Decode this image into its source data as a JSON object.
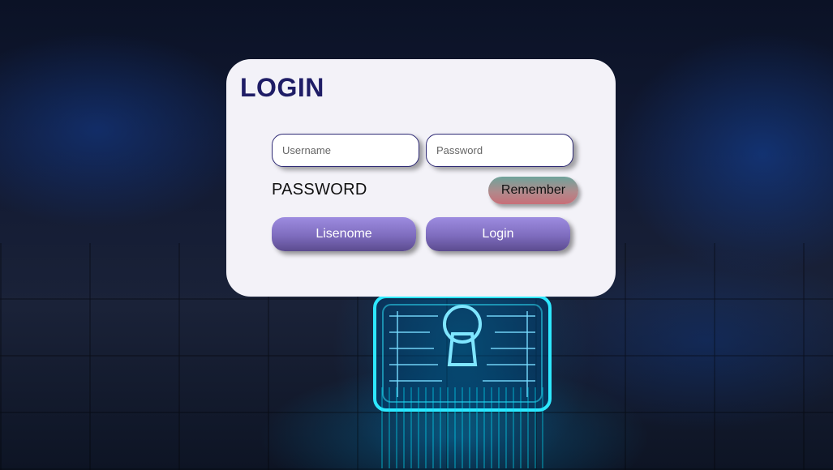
{
  "login_card": {
    "title": "LOGIN",
    "username_field": {
      "value": "",
      "placeholder": "Username"
    },
    "password_field": {
      "value": "",
      "placeholder": "Password"
    },
    "password_label": "PASSWORD",
    "remember_label": "Remember",
    "lisenome_label": "Lisenome",
    "login_label": "Login"
  },
  "colors": {
    "title": "#1f1d66",
    "card_background": "#f3f2f8",
    "button_purple": "#8a78cc",
    "remember_green": "#6fa39b",
    "remember_red": "#c86e78",
    "background_dark": "#121a33",
    "glow_cyan": "#00d2ff"
  },
  "icons": {
    "background_graphic": "padlock-icon"
  }
}
